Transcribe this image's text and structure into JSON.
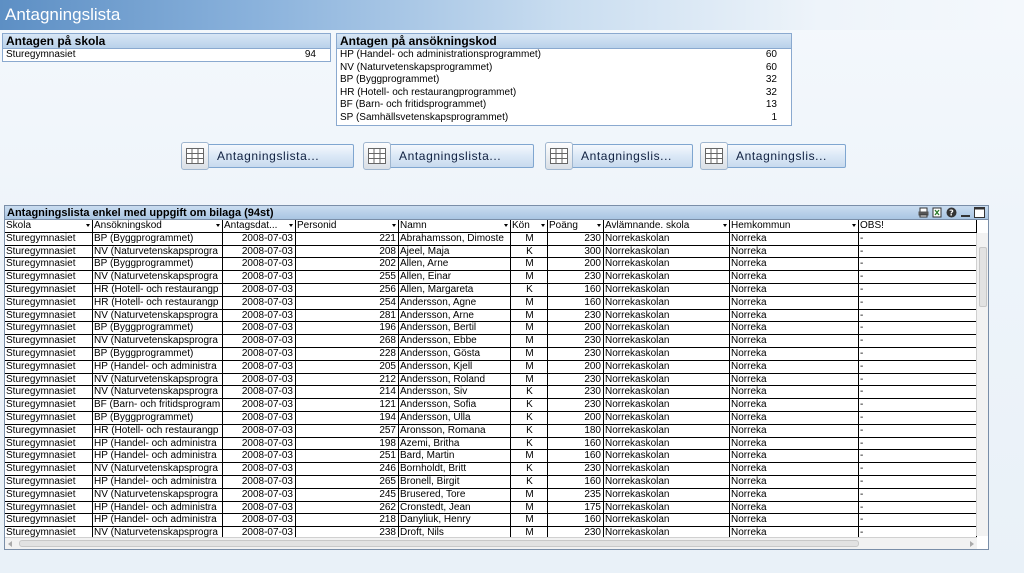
{
  "app": {
    "title": "Antagningslista"
  },
  "school_box": {
    "title": "Antagen på skola",
    "rows": [
      {
        "label": "Sturegymnasiet",
        "value": "94"
      }
    ]
  },
  "code_box": {
    "title": "Antagen på ansökningskod",
    "rows": [
      {
        "label": "HP (Handel- och administrationsprogrammet)",
        "value": "60"
      },
      {
        "label": "NV (Naturvetenskapsprogrammet)",
        "value": "60"
      },
      {
        "label": "BP (Byggprogrammet)",
        "value": "32"
      },
      {
        "label": "HR (Hotell- och restaurangprogrammet)",
        "value": "32"
      },
      {
        "label": "BF (Barn- och fritidsprogrammet)",
        "value": "13"
      },
      {
        "label": "SP (Samhällsvetenskapsprogrammet)",
        "value": "1"
      }
    ]
  },
  "buttons": [
    {
      "label": "Antagningslista..."
    },
    {
      "label": "Antagningslista..."
    },
    {
      "label": "Antagningslis..."
    },
    {
      "label": "Antagningslis..."
    }
  ],
  "table": {
    "caption": "Antagningslista enkel med uppgift om bilaga (94st)",
    "columns": [
      "Skola",
      "Ansökningskod",
      "Antagsdat...",
      "Personid",
      "Namn",
      "Kön",
      "Poäng",
      "Avlämnande. skola",
      "Hemkommun",
      "OBS!"
    ],
    "rows": [
      [
        "Sturegymnasiet",
        "BP (Byggprogrammet)",
        "2008-07-03",
        "221",
        "Abrahamsson, Dimoste",
        "M",
        "230",
        "Norrekaskolan",
        "Norreka",
        "-"
      ],
      [
        "Sturegymnasiet",
        "NV (Naturvetenskapsprogra",
        "2008-07-03",
        "208",
        "Ajeel, Maja",
        "K",
        "300",
        "Norrekaskolan",
        "Norreka",
        "-"
      ],
      [
        "Sturegymnasiet",
        "BP (Byggprogrammet)",
        "2008-07-03",
        "202",
        "Allen, Arne",
        "M",
        "200",
        "Norrekaskolan",
        "Norreka",
        "-"
      ],
      [
        "Sturegymnasiet",
        "NV (Naturvetenskapsprogra",
        "2008-07-03",
        "255",
        "Allen, Einar",
        "M",
        "230",
        "Norrekaskolan",
        "Norreka",
        "-"
      ],
      [
        "Sturegymnasiet",
        "HR (Hotell- och restaurangp",
        "2008-07-03",
        "256",
        "Allen, Margareta",
        "K",
        "160",
        "Norrekaskolan",
        "Norreka",
        "-"
      ],
      [
        "Sturegymnasiet",
        "HR (Hotell- och restaurangp",
        "2008-07-03",
        "254",
        "Andersson, Agne",
        "M",
        "160",
        "Norrekaskolan",
        "Norreka",
        "-"
      ],
      [
        "Sturegymnasiet",
        "NV (Naturvetenskapsprogra",
        "2008-07-03",
        "281",
        "Andersson, Arne",
        "M",
        "230",
        "Norrekaskolan",
        "Norreka",
        "-"
      ],
      [
        "Sturegymnasiet",
        "BP (Byggprogrammet)",
        "2008-07-03",
        "196",
        "Andersson, Bertil",
        "M",
        "200",
        "Norrekaskolan",
        "Norreka",
        "-"
      ],
      [
        "Sturegymnasiet",
        "NV (Naturvetenskapsprogra",
        "2008-07-03",
        "268",
        "Andersson, Ebbe",
        "M",
        "230",
        "Norrekaskolan",
        "Norreka",
        "-"
      ],
      [
        "Sturegymnasiet",
        "BP (Byggprogrammet)",
        "2008-07-03",
        "228",
        "Andersson, Gösta",
        "M",
        "230",
        "Norrekaskolan",
        "Norreka",
        "-"
      ],
      [
        "Sturegymnasiet",
        "HP (Handel- och administra",
        "2008-07-03",
        "205",
        "Andersson, Kjell",
        "M",
        "200",
        "Norrekaskolan",
        "Norreka",
        "-"
      ],
      [
        "Sturegymnasiet",
        "NV (Naturvetenskapsprogra",
        "2008-07-03",
        "212",
        "Andersson, Roland",
        "M",
        "230",
        "Norrekaskolan",
        "Norreka",
        "-"
      ],
      [
        "Sturegymnasiet",
        "NV (Naturvetenskapsprogra",
        "2008-07-03",
        "214",
        "Andersson, Siv",
        "K",
        "230",
        "Norrekaskolan",
        "Norreka",
        "-"
      ],
      [
        "Sturegymnasiet",
        "BF (Barn- och fritidsprogram",
        "2008-07-03",
        "121",
        "Andersson, Sofia",
        "K",
        "230",
        "Norrekaskolan",
        "Norreka",
        "-"
      ],
      [
        "Sturegymnasiet",
        "BP (Byggprogrammet)",
        "2008-07-03",
        "194",
        "Andersson, Ulla",
        "K",
        "200",
        "Norrekaskolan",
        "Norreka",
        "-"
      ],
      [
        "Sturegymnasiet",
        "HR (Hotell- och restaurangp",
        "2008-07-03",
        "257",
        "Aronsson, Romana",
        "K",
        "180",
        "Norrekaskolan",
        "Norreka",
        "-"
      ],
      [
        "Sturegymnasiet",
        "HP (Handel- och administra",
        "2008-07-03",
        "198",
        "Azemi, Britha",
        "K",
        "160",
        "Norrekaskolan",
        "Norreka",
        "-"
      ],
      [
        "Sturegymnasiet",
        "HP (Handel- och administra",
        "2008-07-03",
        "251",
        "Bard, Martin",
        "M",
        "160",
        "Norrekaskolan",
        "Norreka",
        "-"
      ],
      [
        "Sturegymnasiet",
        "NV (Naturvetenskapsprogra",
        "2008-07-03",
        "246",
        "Bornholdt, Britt",
        "K",
        "230",
        "Norrekaskolan",
        "Norreka",
        "-"
      ],
      [
        "Sturegymnasiet",
        "HP (Handel- och administra",
        "2008-07-03",
        "265",
        "Bronell, Birgit",
        "K",
        "160",
        "Norrekaskolan",
        "Norreka",
        "-"
      ],
      [
        "Sturegymnasiet",
        "NV (Naturvetenskapsprogra",
        "2008-07-03",
        "245",
        "Brusered, Tore",
        "M",
        "235",
        "Norrekaskolan",
        "Norreka",
        "-"
      ],
      [
        "Sturegymnasiet",
        "HP (Handel- och administra",
        "2008-07-03",
        "262",
        "Cronstedt, Jean",
        "M",
        "175",
        "Norrekaskolan",
        "Norreka",
        "-"
      ],
      [
        "Sturegymnasiet",
        "HP (Handel- och administra",
        "2008-07-03",
        "218",
        "Danyliuk, Henry",
        "M",
        "160",
        "Norrekaskolan",
        "Norreka",
        "-"
      ],
      [
        "Sturegymnasiet",
        "NV (Naturvetenskapsprogra",
        "2008-07-03",
        "238",
        "Droft, Nils",
        "M",
        "230",
        "Norrekaskolan",
        "Norreka",
        "-"
      ]
    ]
  }
}
